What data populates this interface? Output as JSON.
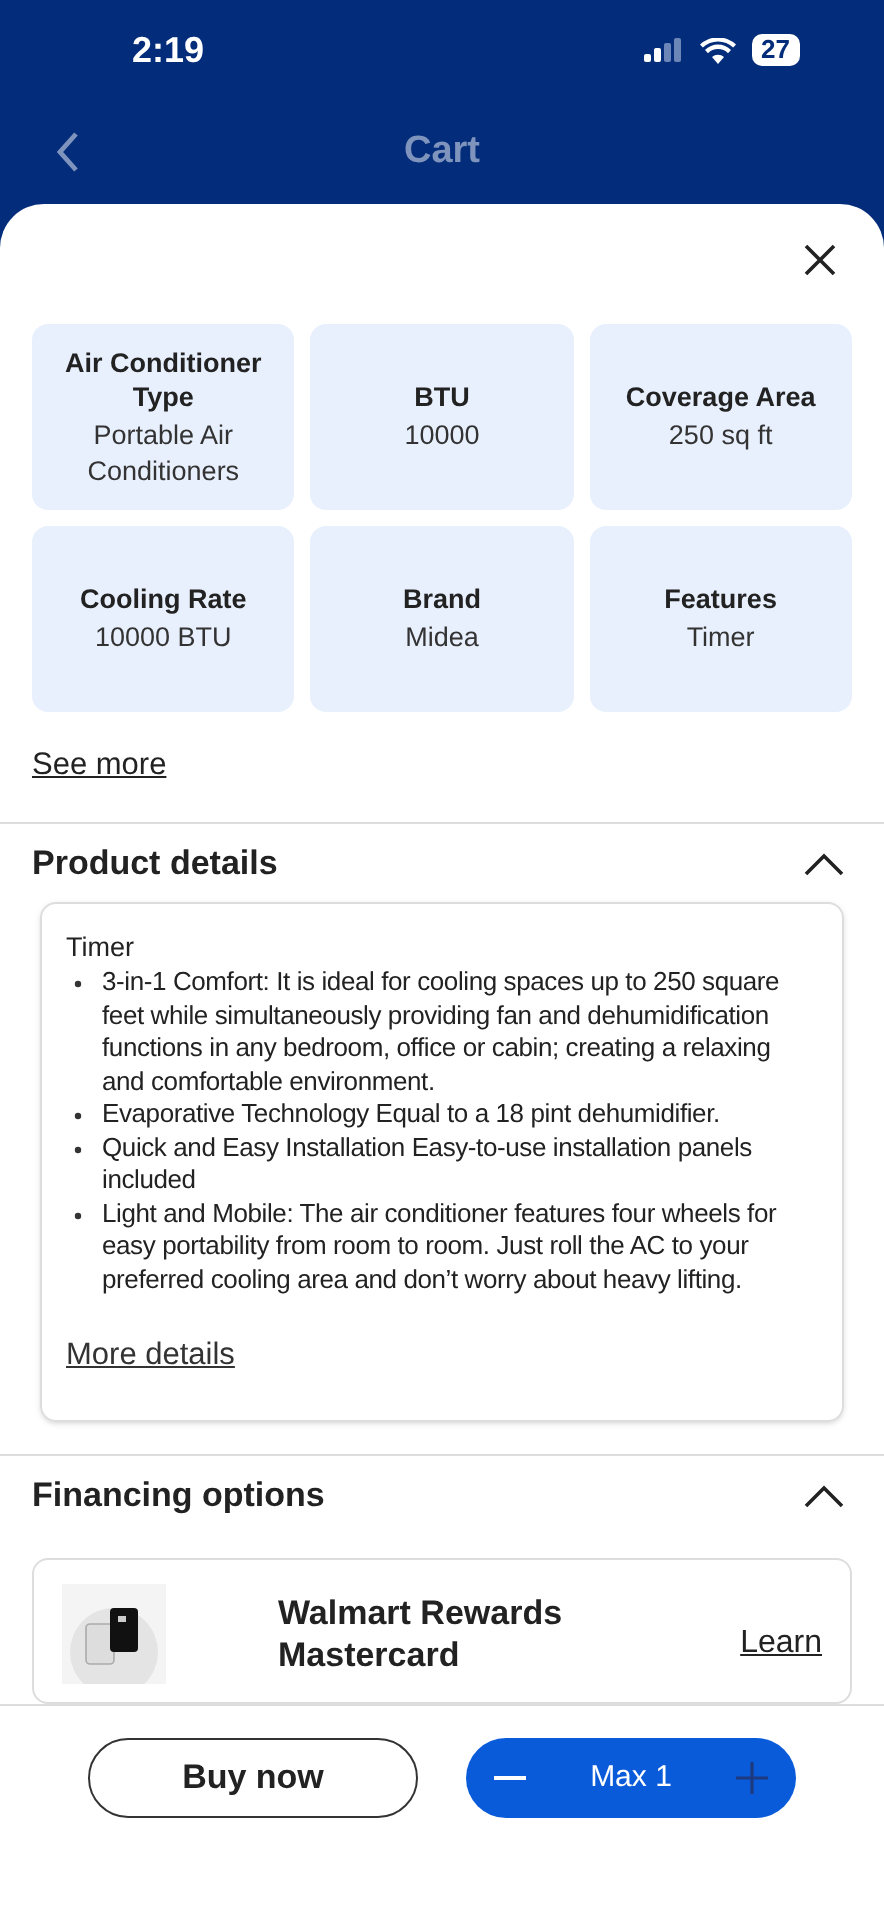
{
  "status_bar": {
    "time": "2:19",
    "battery": "27"
  },
  "nav": {
    "title": "Cart"
  },
  "glance_tiles": [
    {
      "label": "Air Conditioner Type",
      "value": "Portable Air Conditioners"
    },
    {
      "label": "BTU",
      "value": "10000"
    },
    {
      "label": "Coverage Area",
      "value": "250 sq ft"
    },
    {
      "label": "Cooling Rate",
      "value": "10000 BTU"
    },
    {
      "label": "Brand",
      "value": "Midea"
    },
    {
      "label": "Features",
      "value": "Timer"
    }
  ],
  "see_more": "See more",
  "product_details": {
    "title": "Product details",
    "expanded": true,
    "lead": "Timer",
    "bullets": [
      "3-in-1 Comfort: It is ideal for cooling spaces up to 250 square feet while simultaneously providing fan and dehumidification functions in any bedroom, office or cabin; creating a relaxing and comfortable environment.",
      "Evaporative Technology Equal to a 18 pint dehumidifier.",
      "Quick and Easy Installation Easy-to-use installation panels included",
      "Light and Mobile: The air conditioner features four wheels for easy portability from room to room. Just roll the AC to your preferred cooling area and don’t worry about heavy lifting."
    ],
    "more_link": "More details"
  },
  "financing": {
    "title": "Financing options",
    "expanded": true,
    "offer": {
      "name": "Walmart Rewards Mastercard",
      "link": "Learn"
    }
  },
  "actions": {
    "buy_now": "Buy now",
    "quantity": "Max 1"
  }
}
